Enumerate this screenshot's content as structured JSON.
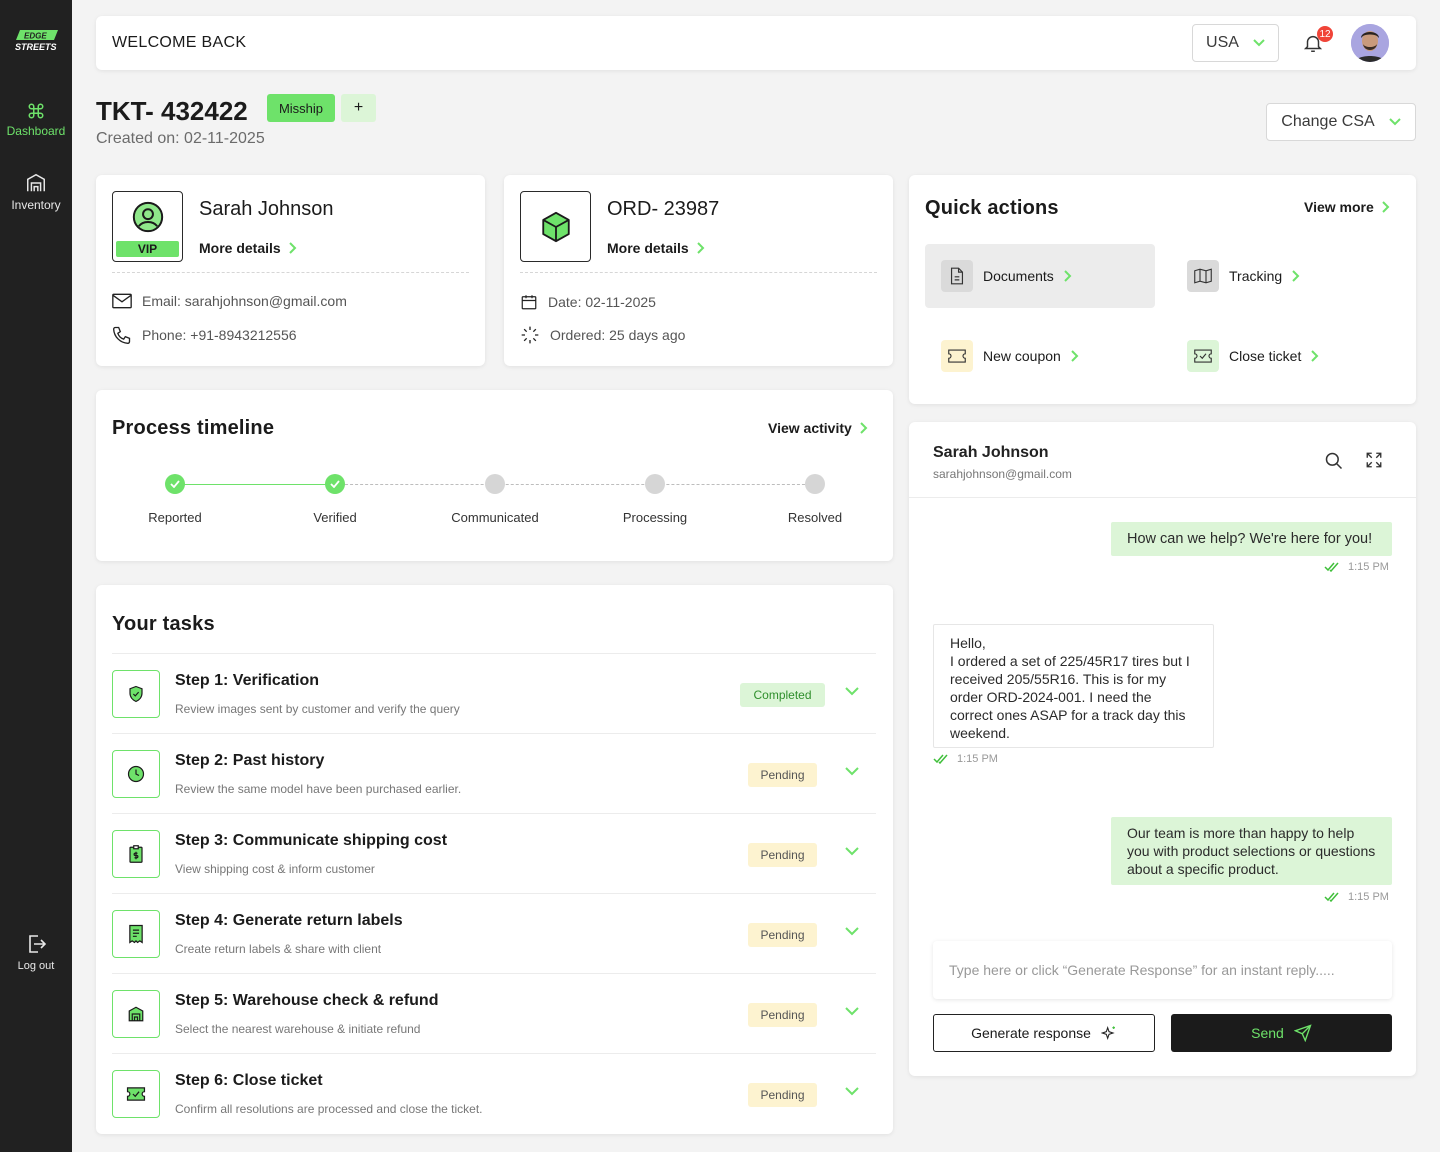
{
  "sidebar": {
    "logo": "EDGE STREETS",
    "items": [
      {
        "label": "Dashboard",
        "icon": "command-icon",
        "active": true
      },
      {
        "label": "Inventory",
        "icon": "warehouse-icon",
        "active": false
      }
    ],
    "logout": "Log out"
  },
  "header": {
    "welcome": "WELCOME BACK",
    "country": "USA",
    "notifications": "12"
  },
  "ticket": {
    "id": "TKT- 432422",
    "tag": "Misship",
    "add": "+",
    "created": "Created on: 02-11-2025",
    "change_csa": "Change CSA"
  },
  "customer": {
    "name": "Sarah Johnson",
    "badge": "VIP",
    "more": "More details",
    "email": "Email: sarahjohnson@gmail.com",
    "phone": "Phone: +91-8943212556"
  },
  "order": {
    "id": "ORD- 23987",
    "more": "More details",
    "date": "Date: 02-11-2025",
    "ordered": "Ordered: 25 days ago"
  },
  "timeline": {
    "title": "Process timeline",
    "link": "View activity",
    "steps": [
      {
        "label": "Reported",
        "done": true
      },
      {
        "label": "Verified",
        "done": true
      },
      {
        "label": "Communicated",
        "done": false
      },
      {
        "label": "Processing",
        "done": false
      },
      {
        "label": "Resolved",
        "done": false
      }
    ]
  },
  "tasks": {
    "title": "Your tasks",
    "items": [
      {
        "title": "Step 1: Verification",
        "desc": "Review images sent by customer and verify the query",
        "status": "Completed",
        "icon": "shield-icon"
      },
      {
        "title": "Step 2: Past history",
        "desc": "Review the same model have been purchased earlier.",
        "status": "Pending",
        "icon": "clock-icon"
      },
      {
        "title": "Step 3: Communicate shipping cost",
        "desc": "View shipping cost & inform customer",
        "status": "Pending",
        "icon": "dollar-clipboard-icon"
      },
      {
        "title": "Step 4: Generate return labels",
        "desc": "Create return labels & share with client",
        "status": "Pending",
        "icon": "receipt-icon"
      },
      {
        "title": "Step 5: Warehouse check & refund",
        "desc": "Select the nearest warehouse & initiate refund",
        "status": "Pending",
        "icon": "warehouse-icon"
      },
      {
        "title": "Step 6: Close ticket",
        "desc": "Confirm all resolutions are processed and close the ticket.",
        "status": "Pending",
        "icon": "ticket-check-icon"
      }
    ]
  },
  "quick_actions": {
    "title": "Quick actions",
    "link": "View more",
    "items": [
      {
        "label": "Documents",
        "icon": "document-icon"
      },
      {
        "label": "Tracking",
        "icon": "map-icon"
      },
      {
        "label": "New coupon",
        "icon": "coupon-icon"
      },
      {
        "label": "Close ticket",
        "icon": "ticket-check-icon"
      }
    ]
  },
  "chat": {
    "name": "Sarah Johnson",
    "email": "sarahjohnson@gmail.com",
    "messages": [
      {
        "from": "agent",
        "text": "How can we help? We're here for you!",
        "time": "1:15 PM"
      },
      {
        "from": "customer",
        "text": "Hello,\nI ordered a set of 225/45R17 tires but I received 205/55R16. This is for my order ORD-2024-001. I need the correct ones ASAP for a track day this weekend.",
        "time": "1:15 PM"
      },
      {
        "from": "agent",
        "text": "Our team is more than happy to help you with product selections or questions about a specific product.",
        "time": "1:15 PM"
      }
    ],
    "placeholder": "Type here or click “Generate Response” for an instant reply.....",
    "generate": "Generate response",
    "send": "Send"
  },
  "colors": {
    "accent": "#6ee26a",
    "accent_light": "#dcf5d7",
    "pending_bg": "#fdf3d0",
    "sidebar": "#212121"
  }
}
